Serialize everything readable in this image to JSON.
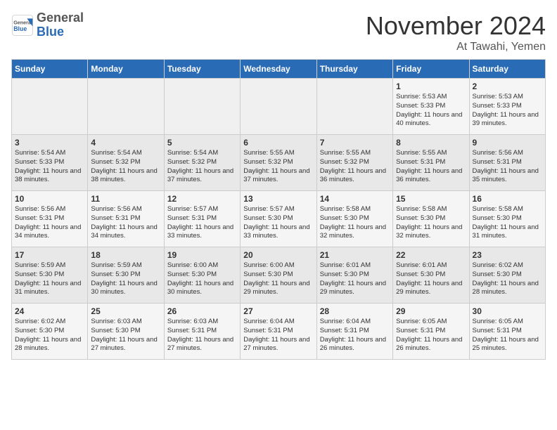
{
  "header": {
    "logo_line1": "General",
    "logo_line2": "Blue",
    "month": "November 2024",
    "location": "At Tawahi, Yemen"
  },
  "weekdays": [
    "Sunday",
    "Monday",
    "Tuesday",
    "Wednesday",
    "Thursday",
    "Friday",
    "Saturday"
  ],
  "weeks": [
    [
      {
        "day": "",
        "info": ""
      },
      {
        "day": "",
        "info": ""
      },
      {
        "day": "",
        "info": ""
      },
      {
        "day": "",
        "info": ""
      },
      {
        "day": "",
        "info": ""
      },
      {
        "day": "1",
        "info": "Sunrise: 5:53 AM\nSunset: 5:33 PM\nDaylight: 11 hours and 40 minutes."
      },
      {
        "day": "2",
        "info": "Sunrise: 5:53 AM\nSunset: 5:33 PM\nDaylight: 11 hours and 39 minutes."
      }
    ],
    [
      {
        "day": "3",
        "info": "Sunrise: 5:54 AM\nSunset: 5:33 PM\nDaylight: 11 hours and 38 minutes."
      },
      {
        "day": "4",
        "info": "Sunrise: 5:54 AM\nSunset: 5:32 PM\nDaylight: 11 hours and 38 minutes."
      },
      {
        "day": "5",
        "info": "Sunrise: 5:54 AM\nSunset: 5:32 PM\nDaylight: 11 hours and 37 minutes."
      },
      {
        "day": "6",
        "info": "Sunrise: 5:55 AM\nSunset: 5:32 PM\nDaylight: 11 hours and 37 minutes."
      },
      {
        "day": "7",
        "info": "Sunrise: 5:55 AM\nSunset: 5:32 PM\nDaylight: 11 hours and 36 minutes."
      },
      {
        "day": "8",
        "info": "Sunrise: 5:55 AM\nSunset: 5:31 PM\nDaylight: 11 hours and 36 minutes."
      },
      {
        "day": "9",
        "info": "Sunrise: 5:56 AM\nSunset: 5:31 PM\nDaylight: 11 hours and 35 minutes."
      }
    ],
    [
      {
        "day": "10",
        "info": "Sunrise: 5:56 AM\nSunset: 5:31 PM\nDaylight: 11 hours and 34 minutes."
      },
      {
        "day": "11",
        "info": "Sunrise: 5:56 AM\nSunset: 5:31 PM\nDaylight: 11 hours and 34 minutes."
      },
      {
        "day": "12",
        "info": "Sunrise: 5:57 AM\nSunset: 5:31 PM\nDaylight: 11 hours and 33 minutes."
      },
      {
        "day": "13",
        "info": "Sunrise: 5:57 AM\nSunset: 5:30 PM\nDaylight: 11 hours and 33 minutes."
      },
      {
        "day": "14",
        "info": "Sunrise: 5:58 AM\nSunset: 5:30 PM\nDaylight: 11 hours and 32 minutes."
      },
      {
        "day": "15",
        "info": "Sunrise: 5:58 AM\nSunset: 5:30 PM\nDaylight: 11 hours and 32 minutes."
      },
      {
        "day": "16",
        "info": "Sunrise: 5:58 AM\nSunset: 5:30 PM\nDaylight: 11 hours and 31 minutes."
      }
    ],
    [
      {
        "day": "17",
        "info": "Sunrise: 5:59 AM\nSunset: 5:30 PM\nDaylight: 11 hours and 31 minutes."
      },
      {
        "day": "18",
        "info": "Sunrise: 5:59 AM\nSunset: 5:30 PM\nDaylight: 11 hours and 30 minutes."
      },
      {
        "day": "19",
        "info": "Sunrise: 6:00 AM\nSunset: 5:30 PM\nDaylight: 11 hours and 30 minutes."
      },
      {
        "day": "20",
        "info": "Sunrise: 6:00 AM\nSunset: 5:30 PM\nDaylight: 11 hours and 29 minutes."
      },
      {
        "day": "21",
        "info": "Sunrise: 6:01 AM\nSunset: 5:30 PM\nDaylight: 11 hours and 29 minutes."
      },
      {
        "day": "22",
        "info": "Sunrise: 6:01 AM\nSunset: 5:30 PM\nDaylight: 11 hours and 29 minutes."
      },
      {
        "day": "23",
        "info": "Sunrise: 6:02 AM\nSunset: 5:30 PM\nDaylight: 11 hours and 28 minutes."
      }
    ],
    [
      {
        "day": "24",
        "info": "Sunrise: 6:02 AM\nSunset: 5:30 PM\nDaylight: 11 hours and 28 minutes."
      },
      {
        "day": "25",
        "info": "Sunrise: 6:03 AM\nSunset: 5:30 PM\nDaylight: 11 hours and 27 minutes."
      },
      {
        "day": "26",
        "info": "Sunrise: 6:03 AM\nSunset: 5:31 PM\nDaylight: 11 hours and 27 minutes."
      },
      {
        "day": "27",
        "info": "Sunrise: 6:04 AM\nSunset: 5:31 PM\nDaylight: 11 hours and 27 minutes."
      },
      {
        "day": "28",
        "info": "Sunrise: 6:04 AM\nSunset: 5:31 PM\nDaylight: 11 hours and 26 minutes."
      },
      {
        "day": "29",
        "info": "Sunrise: 6:05 AM\nSunset: 5:31 PM\nDaylight: 11 hours and 26 minutes."
      },
      {
        "day": "30",
        "info": "Sunrise: 6:05 AM\nSunset: 5:31 PM\nDaylight: 11 hours and 25 minutes."
      }
    ]
  ]
}
